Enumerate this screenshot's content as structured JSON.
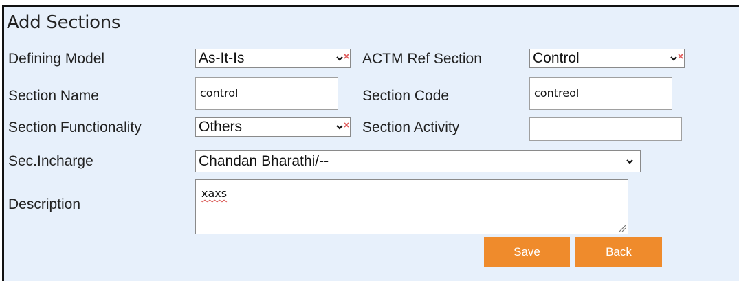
{
  "form": {
    "title": "Add Sections",
    "defining_model": {
      "label": "Defining Model",
      "value": "As-It-Is"
    },
    "actm_ref_section": {
      "label": "ACTM Ref Section",
      "value": "Control"
    },
    "section_name": {
      "label": "Section Name",
      "value": "control"
    },
    "section_code": {
      "label": "Section Code",
      "value": "contreol"
    },
    "section_functionality": {
      "label": "Section Functionality",
      "value": "Others"
    },
    "section_activity": {
      "label": "Section Activity",
      "value": ""
    },
    "sec_incharge": {
      "label": "Sec.Incharge",
      "value": "Chandan Bharathi/--"
    },
    "description": {
      "label": "Description",
      "value": "xaxs"
    }
  },
  "buttons": {
    "save_label": "Save",
    "back_label": "Back"
  },
  "colors": {
    "panel_background": "#e7f0fb",
    "button_orange": "#ef8b2c",
    "frame_border": "#111111"
  },
  "icons": [
    "chevron-down-icon",
    "required-x-icon",
    "resize-grip-icon"
  ]
}
